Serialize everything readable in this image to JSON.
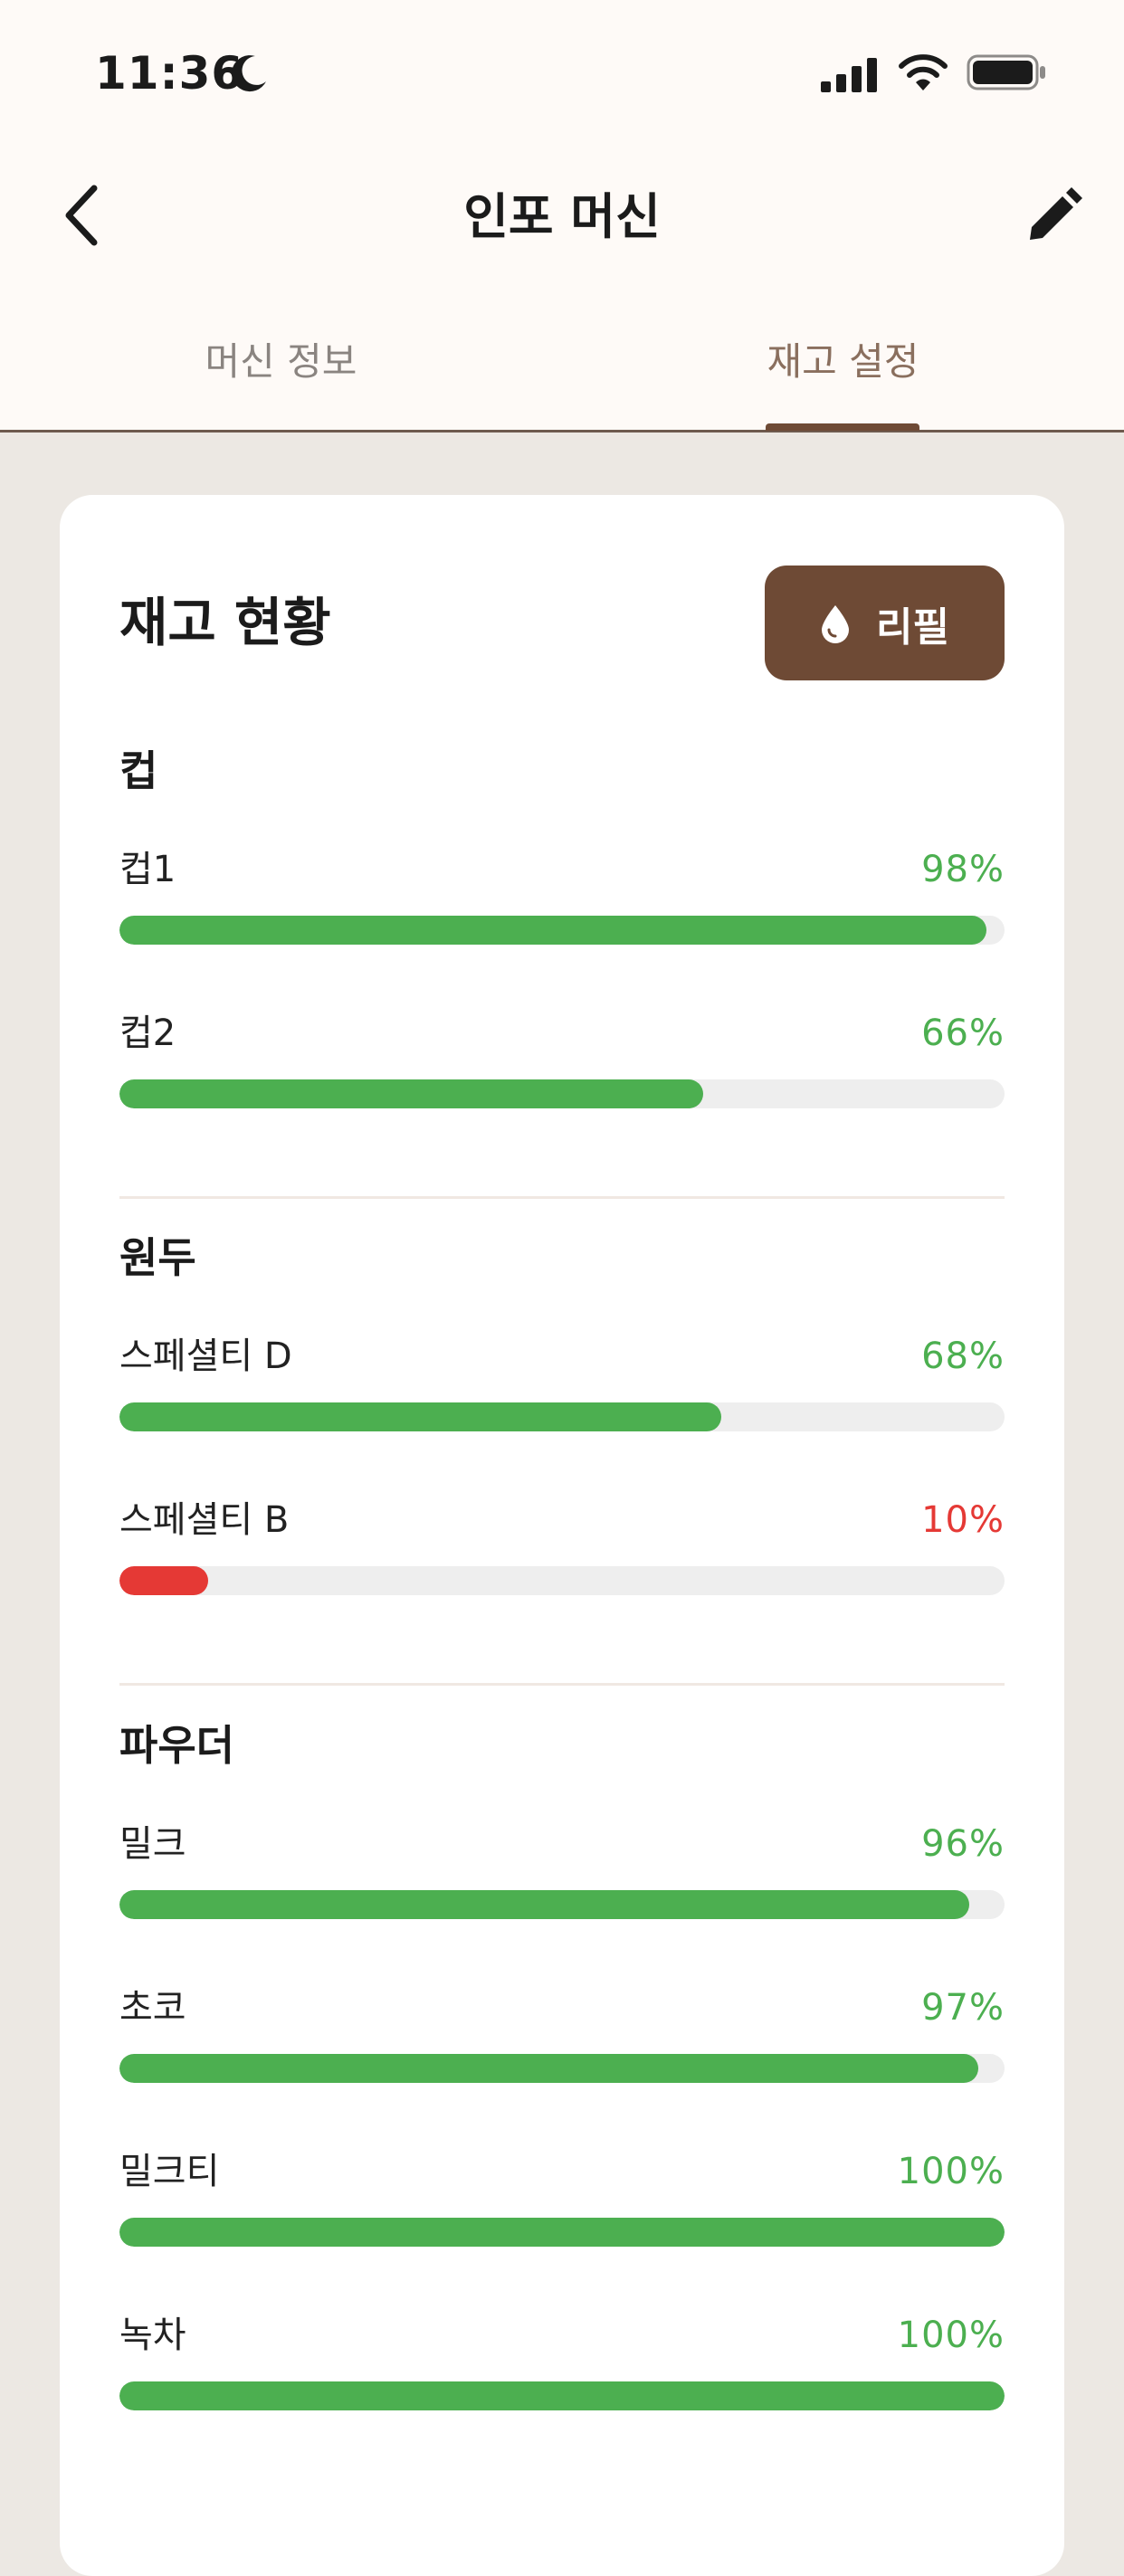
{
  "status_bar": {
    "time": "11:36"
  },
  "nav": {
    "title": "인포 머신"
  },
  "tabs": [
    {
      "label": "머신 정보",
      "active": false
    },
    {
      "label": "재고 설정",
      "active": true
    }
  ],
  "card": {
    "title": "재고 현황",
    "refill_label": "리필"
  },
  "colors": {
    "accent": "#6E4A35",
    "ok": "#4CAF50",
    "low": "#E53935",
    "track": "#EEEEEE"
  },
  "sections": [
    {
      "title": "컵",
      "items": [
        {
          "label": "컵1",
          "percent": 98,
          "percent_text": "98%",
          "status": "ok"
        },
        {
          "label": "컵2",
          "percent": 66,
          "percent_text": "66%",
          "status": "ok"
        }
      ]
    },
    {
      "title": "원두",
      "items": [
        {
          "label": "스페셜티 D",
          "percent": 68,
          "percent_text": "68%",
          "status": "ok"
        },
        {
          "label": "스페셜티 B",
          "percent": 10,
          "percent_text": "10%",
          "status": "low"
        }
      ]
    },
    {
      "title": "파우더",
      "items": [
        {
          "label": "밀크",
          "percent": 96,
          "percent_text": "96%",
          "status": "ok"
        },
        {
          "label": "초코",
          "percent": 97,
          "percent_text": "97%",
          "status": "ok"
        },
        {
          "label": "밀크티",
          "percent": 100,
          "percent_text": "100%",
          "status": "ok"
        },
        {
          "label": "녹차",
          "percent": 100,
          "percent_text": "100%",
          "status": "ok"
        }
      ]
    }
  ]
}
